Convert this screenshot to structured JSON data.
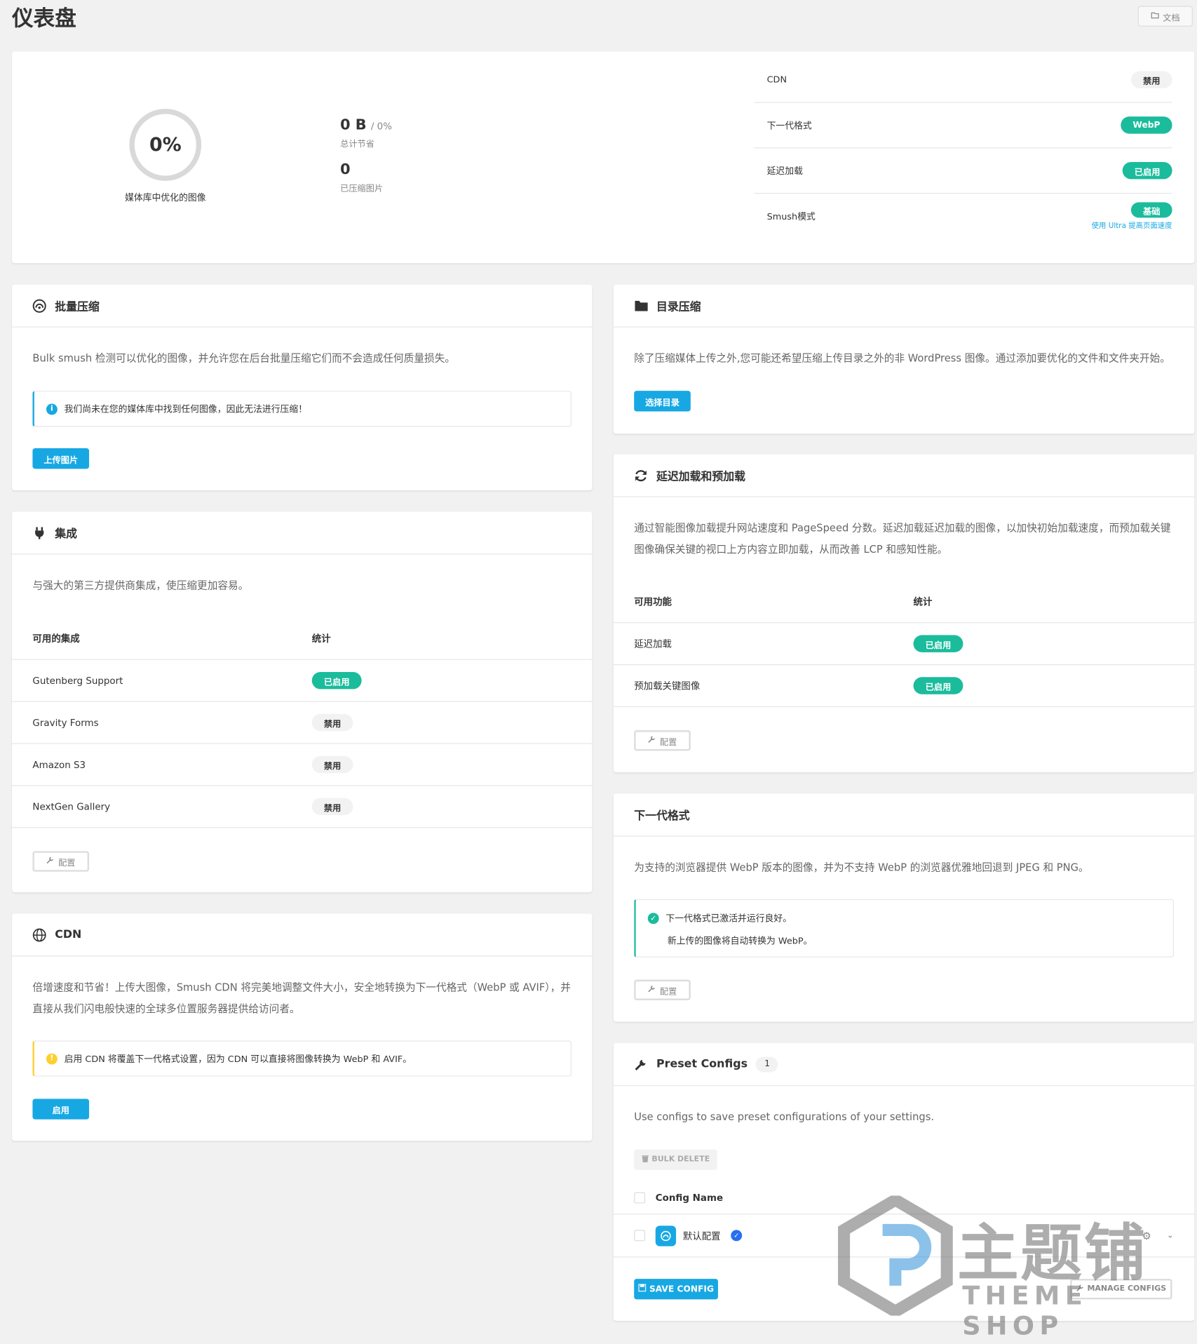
{
  "page": {
    "title": "仪表盘",
    "doc_label": "文档"
  },
  "summary": {
    "score": "0%",
    "score_label": "媒体库中优化的图像",
    "savings_value": "0 B",
    "savings_pct": "/ 0%",
    "savings_label": "总计节省",
    "count_value": "0",
    "count_label": "已压缩图片",
    "rows": [
      {
        "label": "CDN",
        "value": "禁用",
        "state": "off"
      },
      {
        "label": "下一代格式",
        "value": "WebP",
        "state": "on"
      },
      {
        "label": "延迟加载",
        "value": "已启用",
        "state": "on"
      },
      {
        "label": "Smush模式",
        "value": "基础",
        "state": "on",
        "link": "使用 Ultra 提高页面速度"
      }
    ]
  },
  "bulk": {
    "title": "批量压缩",
    "desc": "Bulk smush 检测可以优化的图像，并允许您在后台批量压缩它们而不会造成任何质量损失。",
    "notice": "我们尚未在您的媒体库中找到任何图像，因此无法进行压缩！",
    "button": "上传图片"
  },
  "integrations": {
    "title": "集成",
    "desc": "与强大的第三方提供商集成，使压缩更加容易。",
    "col1": "可用的集成",
    "col2": "统计",
    "rows": [
      {
        "name": "Gutenberg Support",
        "status": "已启用",
        "state": "on"
      },
      {
        "name": "Gravity Forms",
        "status": "禁用",
        "state": "off"
      },
      {
        "name": "Amazon S3",
        "status": "禁用",
        "state": "off"
      },
      {
        "name": "NextGen Gallery",
        "status": "禁用",
        "state": "off"
      }
    ],
    "config_label": "配置"
  },
  "cdn": {
    "title": "CDN",
    "desc": "倍增速度和节省！上传大图像，Smush CDN 将完美地调整文件大小，安全地转换为下一代格式（WebP 或 AVIF），并直接从我们闪电般快速的全球多位置服务器提供给访问者。",
    "notice": "启用 CDN 将覆盖下一代格式设置，因为 CDN 可以直接将图像转换为 WebP 和 AVIF。",
    "button": "启用"
  },
  "directory": {
    "title": "目录压缩",
    "desc": "除了压缩媒体上传之外,您可能还希望压缩上传目录之外的非 WordPress 图像。通过添加要优化的文件和文件夹开始。",
    "button": "选择目录"
  },
  "lazy": {
    "title": "延迟加载和预加载",
    "desc": "通过智能图像加载提升网站速度和 PageSpeed 分数。延迟加载延迟加载的图像，以加快初始加载速度，而预加载关键图像确保关键的视口上方内容立即加载，从而改善 LCP 和感知性能。",
    "col1": "可用功能",
    "col2": "统计",
    "rows": [
      {
        "name": "延迟加载",
        "status": "已启用"
      },
      {
        "name": "预加载关键图像",
        "status": "已启用"
      }
    ],
    "config_label": "配置"
  },
  "nextgen": {
    "title": "下一代格式",
    "desc": "为支持的浏览器提供 WebP 版本的图像，并为不支持 WebP 的浏览器优雅地回退到 JPEG 和 PNG。",
    "notice_line1": "下一代格式已激活并运行良好。",
    "notice_line2": "新上传的图像将自动转换为 WebP。",
    "config_label": "配置"
  },
  "presets": {
    "title": "Preset Configs",
    "count": "1",
    "desc": "Use configs to save preset configurations of your settings.",
    "bulk_delete": "BULK DELETE",
    "col_name": "Config Name",
    "config_item": "默认配置",
    "save_button": "SAVE CONFIG",
    "manage_button": "MANAGE CONFIGS"
  },
  "watermark": {
    "cn": "主题铺",
    "en": "THEME SHOP"
  },
  "colors": {
    "accent_blue": "#17a8e3",
    "success_green": "#1abc9c",
    "warning_yellow": "#fecf2f",
    "info_blue": "#17a8e3"
  }
}
